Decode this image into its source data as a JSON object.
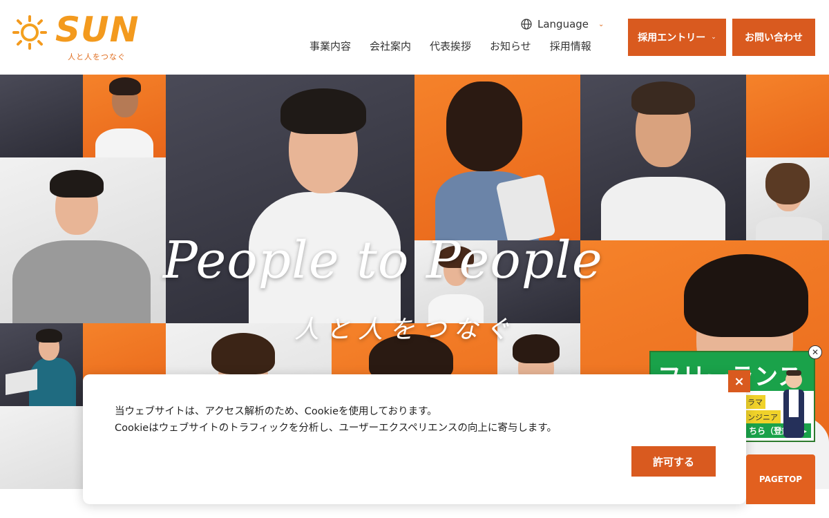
{
  "brand": {
    "logo_word": "SUN",
    "tagline": "人と人をつなぐ",
    "colors": {
      "accent": "#d95a1f",
      "orange": "#f5822a",
      "dark": "#3a3a46",
      "green": "#1aa24a"
    }
  },
  "header": {
    "language_label": "Language",
    "nav": [
      "事業内容",
      "会社案内",
      "代表挨拶",
      "お知らせ",
      "採用情報"
    ],
    "entry_button": "採用エントリー",
    "contact_button": "お問い合わせ"
  },
  "hero": {
    "headline": "People to People",
    "subline": "人と人をつなぐ"
  },
  "freelance_banner": {
    "title": "フリーランス",
    "tag1": "ラマ",
    "tag2": "ンジニア",
    "cta": "ちら（登録）▸▸"
  },
  "cookie": {
    "line1": "当ウェブサイトは、アクセス解析のため、Cookieを使用しております。",
    "line2": "Cookieはウェブサイトのトラフィックを分析し、ユーザーエクスペリエンスの向上に寄与します。",
    "accept_label": "許可する",
    "close_label": "×"
  },
  "pagetop_label": "PAGETOP",
  "icons": {
    "globe": "globe-icon",
    "chevron": "chevron-down-icon",
    "close": "close-icon",
    "sun": "sun-logo-icon"
  }
}
